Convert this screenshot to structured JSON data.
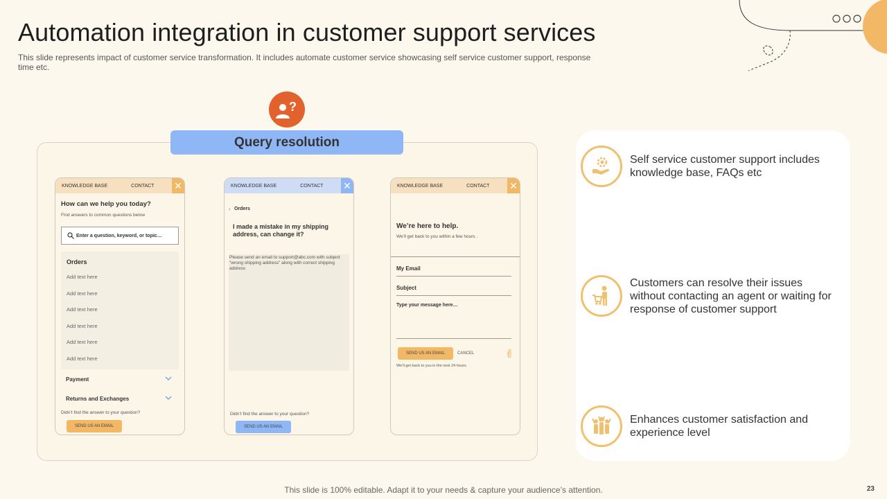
{
  "slide": {
    "title": "Automation integration in customer support services",
    "subtitle": "This slide represents impact of customer service transformation. It includes automate customer service showcasing self service customer support, response time etc.",
    "footer": "This slide is 100% editable. Adapt it to your needs & capture your audience’s attention.",
    "page_number": "23"
  },
  "query": {
    "banner": "Query resolution"
  },
  "phone1": {
    "tab_kb": "KNOWLEDGE BASE",
    "tab_contact": "CONTACT",
    "close": "✕",
    "heading": "How can we help you today?",
    "subtext": "Find answers to common questions below",
    "search_placeholder": "Enter a question, keyword, or topic…",
    "orders_title": "Orders",
    "items": [
      "Add text here",
      "Add text here",
      "Add text here",
      "Add text here",
      "Add text here",
      "Add text here"
    ],
    "payment": "Payment",
    "returns": "Returns and Exchanges",
    "not_found": "Didn’t find the answer to your question?",
    "email_button": "SEND US AN EMAIL"
  },
  "phone2": {
    "tab_kb": "KNOWLEDGE BASE",
    "tab_contact": "CONTACT",
    "close": "✕",
    "back": "‹",
    "breadcrumb": "Orders",
    "question": "I made a mistake in my shipping address, can change it?",
    "answer": "Please send an email to support@abc.com with subject \"wrong shipping address\" along with correct shipping address",
    "not_found": "Didn’t find the answer to your question?",
    "email_button": "SEND US AN EMAIL"
  },
  "phone3": {
    "tab_kb": "KNOWLEDGE BASE",
    "tab_contact": "CONTACT",
    "close": "✕",
    "heading": "We’re here to help.",
    "subtext": "We’ll get back to you within a few hours .",
    "field_email": "My Email",
    "field_subject": "Subject",
    "field_message": "Type your message here…",
    "send_button": "SEND US AN EMAIL",
    "cancel": "CANCEL",
    "note": "We’ll get back to you in the next 24 hours."
  },
  "benefits": [
    {
      "text": "Self service customer support includes knowledge base, FAQs etc",
      "icon": "hand-gear-icon"
    },
    {
      "text": "Customers can resolve their issues without contacting an agent or waiting for response of customer support",
      "icon": "shopper-cart-icon"
    },
    {
      "text": "Enhances customer satisfaction and experience level",
      "icon": "happy-group-icon"
    }
  ],
  "colors": {
    "accent_orange": "#f3b866",
    "accent_blue": "#8fb7f5",
    "icon_red": "#e2622d",
    "background": "#fcf8ee"
  }
}
